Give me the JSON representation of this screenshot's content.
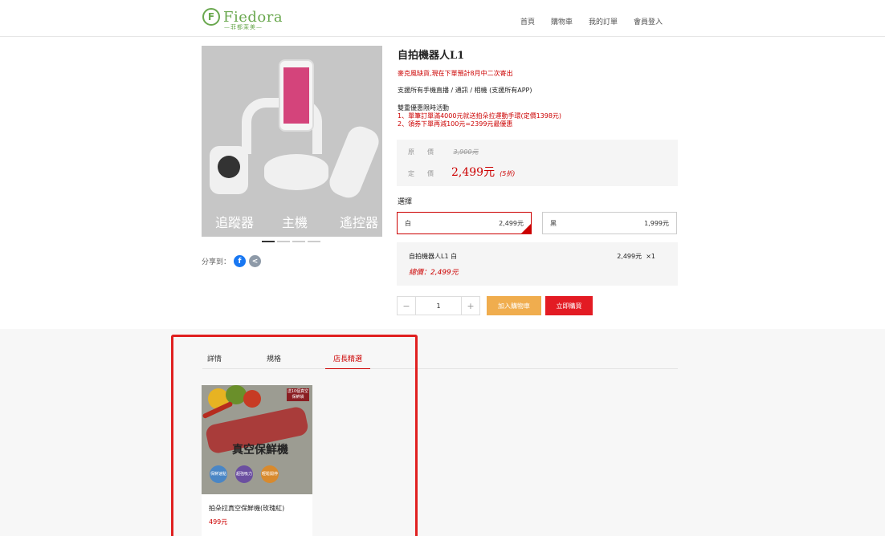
{
  "header": {
    "logo_text": "Fiedora",
    "logo_sub": "—菲都茉美—",
    "nav": [
      "首頁",
      "購物車",
      "我的訂單",
      "會員登入"
    ]
  },
  "gallery": {
    "labels": [
      "追蹤器",
      "主機",
      "遙控器"
    ],
    "dots_count": 4,
    "active_dot": 1
  },
  "share": {
    "label": "分享到：",
    "facebook_glyph": "f",
    "share_glyph": "<"
  },
  "product": {
    "title": "自拍機器人L1",
    "notice": "麥克風缺貨,現在下單預計8月中二次寄出",
    "support": "支援所有手機直播 / 通訊 / 相機 (支援所有APP)",
    "promo_title": "雙重優惠限時活動",
    "promo_1": "1、單筆訂單滿4000元就送拍朵拉運動手環(定價1398元)",
    "promo_2": "2、領券下單再減100元=2399元最優惠"
  },
  "price": {
    "orig_label": "原　　價",
    "orig_value": "3,900元",
    "sale_label": "定　　價",
    "sale_value": "2,499元",
    "discount": "(5折)"
  },
  "select": {
    "label": "選擇",
    "options": [
      {
        "name": "白",
        "price": "2,499元"
      },
      {
        "name": "黑",
        "price": "1,999元"
      }
    ]
  },
  "summary": {
    "name": "自拍機器人L1 白",
    "price": "2,499元",
    "qty": "×1",
    "total": "總價：2,499元"
  },
  "quantity": {
    "minus": "−",
    "value": "1",
    "plus": "+"
  },
  "buttons": {
    "cart": "加入購物車",
    "buy": "立即購買"
  },
  "tabs": [
    "詳情",
    "規格",
    "店長精選"
  ],
  "recommend": {
    "name": "拍朵拉真空保鮮機(玫瑰紅)",
    "price": "499元",
    "img_text": "真空保鮮機",
    "badge": "送10個真空保鮮袋",
    "circles": [
      "保鮮速點",
      "超強吸力",
      "輕鬆開停"
    ]
  },
  "colors": {
    "brand_green": "#6aa84f",
    "accent_red": "#c00000",
    "cart_orange": "#f0ad4e",
    "buy_red": "#e31b23"
  }
}
